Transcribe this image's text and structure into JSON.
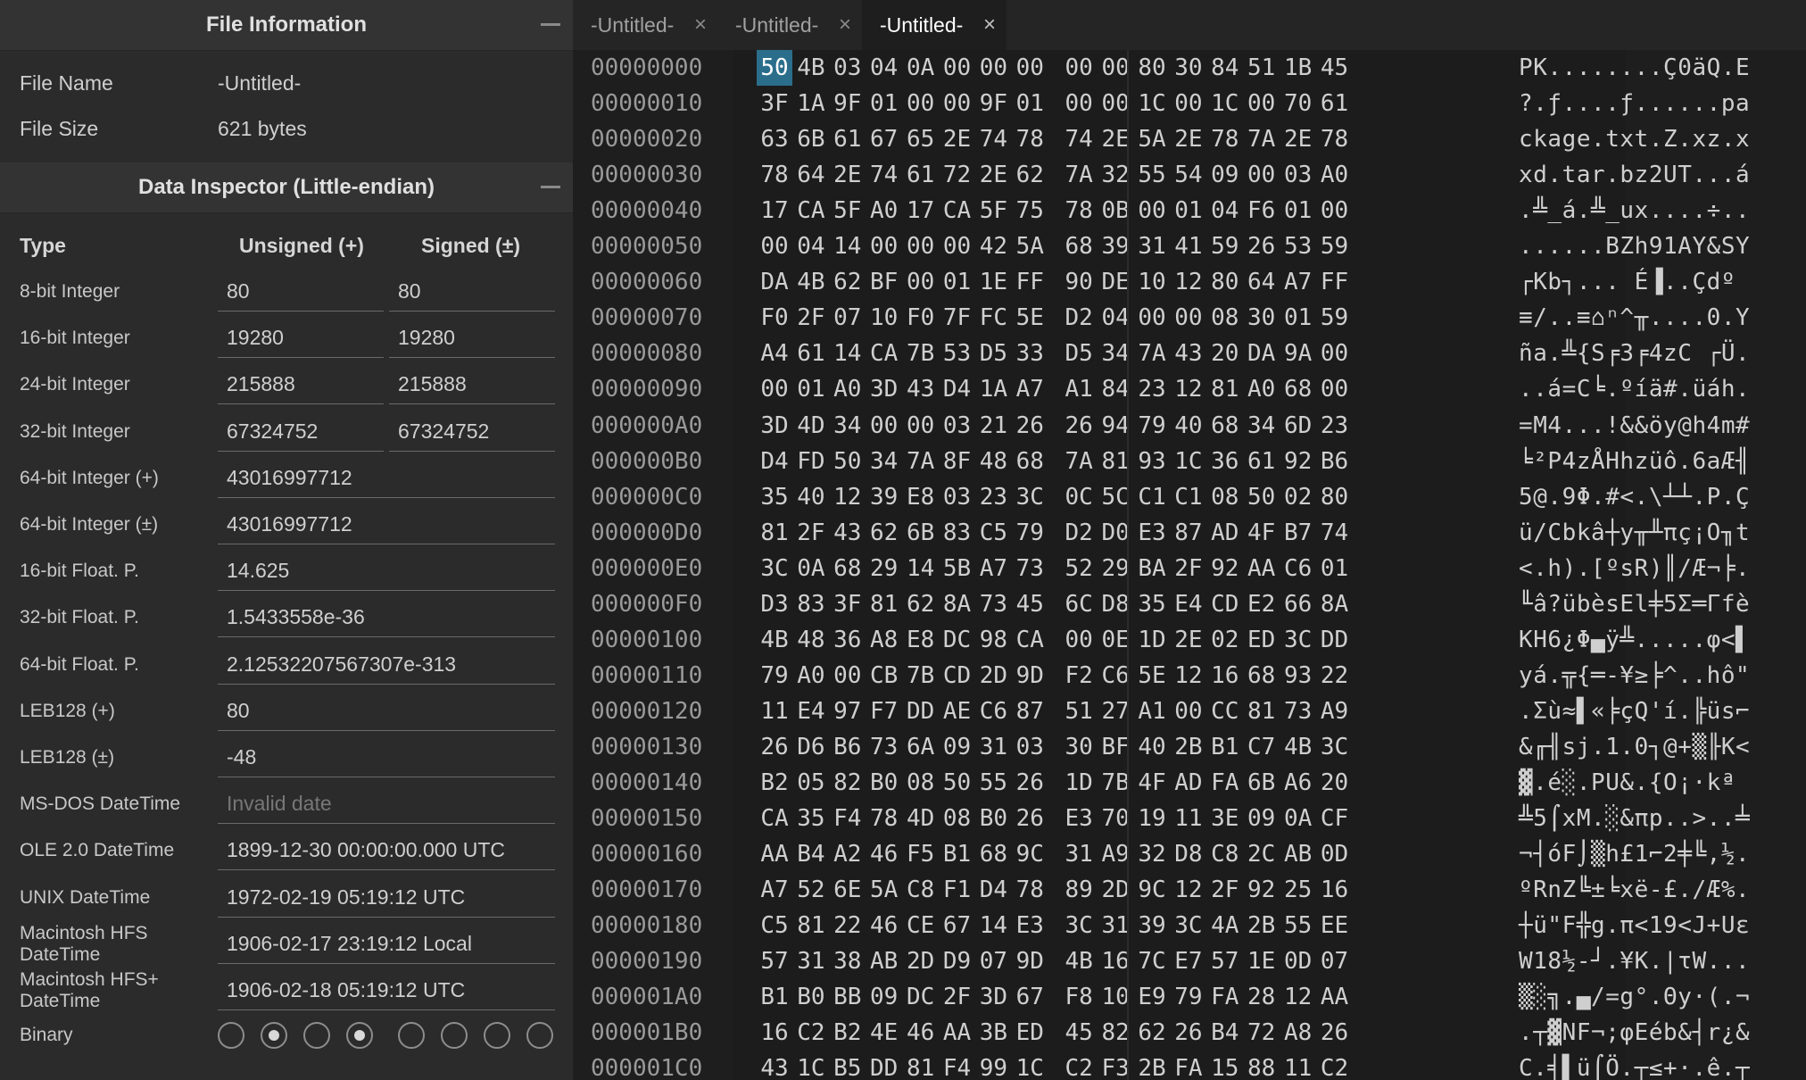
{
  "file_info": {
    "title": "File Information",
    "name_label": "File Name",
    "name_value": "-Untitled-",
    "size_label": "File Size",
    "size_value": "621 bytes"
  },
  "inspector": {
    "title": "Data Inspector (Little-endian)",
    "col_type": "Type",
    "col_unsigned": "Unsigned (+)",
    "col_signed": "Signed (±)",
    "rows": [
      {
        "label": "8-bit Integer",
        "unsigned": "80",
        "signed": "80"
      },
      {
        "label": "16-bit Integer",
        "unsigned": "19280",
        "signed": "19280"
      },
      {
        "label": "24-bit Integer",
        "unsigned": "215888",
        "signed": "215888"
      },
      {
        "label": "32-bit Integer",
        "unsigned": "67324752",
        "signed": "67324752"
      },
      {
        "label": "64-bit Integer (+)",
        "value": "43016997712"
      },
      {
        "label": "64-bit Integer (±)",
        "value": "43016997712"
      },
      {
        "label": "16-bit Float. P.",
        "value": "14.625"
      },
      {
        "label": "32-bit Float. P.",
        "value": "1.5433558e-36"
      },
      {
        "label": "64-bit Float. P.",
        "value": "2.12532207567307e-313"
      },
      {
        "label": "LEB128 (+)",
        "value": "80"
      },
      {
        "label": "LEB128 (±)",
        "value": "-48"
      },
      {
        "label": "MS-DOS DateTime",
        "placeholder": "Invalid date"
      },
      {
        "label": "OLE 2.0 DateTime",
        "value": "1899-12-30 00:00:00.000 UTC"
      },
      {
        "label": "UNIX DateTime",
        "value": "1972-02-19 05:19:12 UTC"
      },
      {
        "label": "Macintosh HFS DateTime",
        "value": "1906-02-17 23:19:12 Local"
      },
      {
        "label": "Macintosh HFS+ DateTime",
        "value": "1906-02-18 05:19:12 UTC"
      }
    ],
    "binary_label": "Binary",
    "binary_bits": [
      0,
      1,
      0,
      1,
      0,
      0,
      0,
      0
    ]
  },
  "tabs": [
    {
      "label": "-Untitled-",
      "active": false
    },
    {
      "label": "-Untitled-",
      "active": false
    },
    {
      "label": "-Untitled-",
      "active": true
    }
  ],
  "tab_close_glyph": "×",
  "colors": {
    "selection": "#2b6e8c",
    "background": "#1e1e1e",
    "panel": "#2b2b2b"
  },
  "hex": {
    "selected_offset": "00000000",
    "selected_byte_index": 0,
    "rows": [
      {
        "offset": "00000000",
        "bytes": [
          "50",
          "4B",
          "03",
          "04",
          "0A",
          "00",
          "00",
          "00",
          "00",
          "00",
          "80",
          "30",
          "84",
          "51",
          "1B",
          "45"
        ],
        "ascii": "PK........Ç0äQ.E"
      },
      {
        "offset": "00000010",
        "bytes": [
          "3F",
          "1A",
          "9F",
          "01",
          "00",
          "00",
          "9F",
          "01",
          "00",
          "00",
          "1C",
          "00",
          "1C",
          "00",
          "70",
          "61"
        ],
        "ascii": "?.ƒ....ƒ......pa"
      },
      {
        "offset": "00000020",
        "bytes": [
          "63",
          "6B",
          "61",
          "67",
          "65",
          "2E",
          "74",
          "78",
          "74",
          "2E",
          "5A",
          "2E",
          "78",
          "7A",
          "2E",
          "78"
        ],
        "ascii": "ckage.txt.Z.xz.x"
      },
      {
        "offset": "00000030",
        "bytes": [
          "78",
          "64",
          "2E",
          "74",
          "61",
          "72",
          "2E",
          "62",
          "7A",
          "32",
          "55",
          "54",
          "09",
          "00",
          "03",
          "A0"
        ],
        "ascii": "xd.tar.bz2UT...á"
      },
      {
        "offset": "00000040",
        "bytes": [
          "17",
          "CA",
          "5F",
          "A0",
          "17",
          "CA",
          "5F",
          "75",
          "78",
          "0B",
          "00",
          "01",
          "04",
          "F6",
          "01",
          "00"
        ],
        "ascii": ".╩_á.╩_ux....÷.."
      },
      {
        "offset": "00000050",
        "bytes": [
          "00",
          "04",
          "14",
          "00",
          "00",
          "00",
          "42",
          "5A",
          "68",
          "39",
          "31",
          "41",
          "59",
          "26",
          "53",
          "59"
        ],
        "ascii": "......BZh91AY&SY"
      },
      {
        "offset": "00000060",
        "bytes": [
          "DA",
          "4B",
          "62",
          "BF",
          "00",
          "01",
          "1E",
          "FF",
          "90",
          "DE",
          "10",
          "12",
          "80",
          "64",
          "A7",
          "FF"
        ],
        "ascii": "┌Kb┐... É▐..Çdº "
      },
      {
        "offset": "00000070",
        "bytes": [
          "F0",
          "2F",
          "07",
          "10",
          "F0",
          "7F",
          "FC",
          "5E",
          "D2",
          "04",
          "00",
          "00",
          "08",
          "30",
          "01",
          "59"
        ],
        "ascii": "≡/..≡⌂ⁿ^╥....0.Y"
      },
      {
        "offset": "00000080",
        "bytes": [
          "A4",
          "61",
          "14",
          "CA",
          "7B",
          "53",
          "D5",
          "33",
          "D5",
          "34",
          "7A",
          "43",
          "20",
          "DA",
          "9A",
          "00"
        ],
        "ascii": "ña.╩{S╒3╒4zC ┌Ü."
      },
      {
        "offset": "00000090",
        "bytes": [
          "00",
          "01",
          "A0",
          "3D",
          "43",
          "D4",
          "1A",
          "A7",
          "A1",
          "84",
          "23",
          "12",
          "81",
          "A0",
          "68",
          "00"
        ],
        "ascii": "..á=C╘.ºíä#.üáh."
      },
      {
        "offset": "000000A0",
        "bytes": [
          "3D",
          "4D",
          "34",
          "00",
          "00",
          "03",
          "21",
          "26",
          "26",
          "94",
          "79",
          "40",
          "68",
          "34",
          "6D",
          "23"
        ],
        "ascii": "=M4...!&&öy@h4m#"
      },
      {
        "offset": "000000B0",
        "bytes": [
          "D4",
          "FD",
          "50",
          "34",
          "7A",
          "8F",
          "48",
          "68",
          "7A",
          "81",
          "93",
          "1C",
          "36",
          "61",
          "92",
          "B6"
        ],
        "ascii": "╘²P4zÅHhzüô.6aÆ╢"
      },
      {
        "offset": "000000C0",
        "bytes": [
          "35",
          "40",
          "12",
          "39",
          "E8",
          "03",
          "23",
          "3C",
          "0C",
          "5C",
          "C1",
          "C1",
          "08",
          "50",
          "02",
          "80"
        ],
        "ascii": "5@.9Φ.#<.\\┴┴.P.Ç"
      },
      {
        "offset": "000000D0",
        "bytes": [
          "81",
          "2F",
          "43",
          "62",
          "6B",
          "83",
          "C5",
          "79",
          "D2",
          "D0",
          "E3",
          "87",
          "AD",
          "4F",
          "B7",
          "74"
        ],
        "ascii": "ü/Cbkâ┼y╥╨πç¡O╖t"
      },
      {
        "offset": "000000E0",
        "bytes": [
          "3C",
          "0A",
          "68",
          "29",
          "14",
          "5B",
          "A7",
          "73",
          "52",
          "29",
          "BA",
          "2F",
          "92",
          "AA",
          "C6",
          "01"
        ],
        "ascii": "<.h).[ºsR)║/Æ¬╞."
      },
      {
        "offset": "000000F0",
        "bytes": [
          "D3",
          "83",
          "3F",
          "81",
          "62",
          "8A",
          "73",
          "45",
          "6C",
          "D8",
          "35",
          "E4",
          "CD",
          "E2",
          "66",
          "8A"
        ],
        "ascii": "╙â?übèsEl╪5Σ═Γfè"
      },
      {
        "offset": "00000100",
        "bytes": [
          "4B",
          "48",
          "36",
          "A8",
          "E8",
          "DC",
          "98",
          "CA",
          "00",
          "0E",
          "1D",
          "2E",
          "02",
          "ED",
          "3C",
          "DD"
        ],
        "ascii": "KH6¿Φ▄ÿ╩.....φ<▌"
      },
      {
        "offset": "00000110",
        "bytes": [
          "79",
          "A0",
          "00",
          "CB",
          "7B",
          "CD",
          "2D",
          "9D",
          "F2",
          "C6",
          "5E",
          "12",
          "16",
          "68",
          "93",
          "22"
        ],
        "ascii": "yá.╦{═-¥≥╞^..hô\""
      },
      {
        "offset": "00000120",
        "bytes": [
          "11",
          "E4",
          "97",
          "F7",
          "DD",
          "AE",
          "C6",
          "87",
          "51",
          "27",
          "A1",
          "00",
          "CC",
          "81",
          "73",
          "A9"
        ],
        "ascii": ".Σù≈▌«╞çQ'í.╠üs⌐"
      },
      {
        "offset": "00000130",
        "bytes": [
          "26",
          "D6",
          "B6",
          "73",
          "6A",
          "09",
          "31",
          "03",
          "30",
          "BF",
          "40",
          "2B",
          "B1",
          "C7",
          "4B",
          "3C"
        ],
        "ascii": "&╓╢sj.1.0┐@+▒╟K<"
      },
      {
        "offset": "00000140",
        "bytes": [
          "B2",
          "05",
          "82",
          "B0",
          "08",
          "50",
          "55",
          "26",
          "1D",
          "7B",
          "4F",
          "AD",
          "FA",
          "6B",
          "A6",
          "20"
        ],
        "ascii": "▓.é░.PU&.{O¡·kª "
      },
      {
        "offset": "00000150",
        "bytes": [
          "CA",
          "35",
          "F4",
          "78",
          "4D",
          "08",
          "B0",
          "26",
          "E3",
          "70",
          "19",
          "11",
          "3E",
          "09",
          "0A",
          "CF"
        ],
        "ascii": "╩5⌠xM.░&πp..>..╧"
      },
      {
        "offset": "00000160",
        "bytes": [
          "AA",
          "B4",
          "A2",
          "46",
          "F5",
          "B1",
          "68",
          "9C",
          "31",
          "A9",
          "32",
          "D8",
          "C8",
          "2C",
          "AB",
          "0D"
        ],
        "ascii": "¬┤óF⌡▒h£1⌐2╪╚,½."
      },
      {
        "offset": "00000170",
        "bytes": [
          "A7",
          "52",
          "6E",
          "5A",
          "C8",
          "F1",
          "D4",
          "78",
          "89",
          "2D",
          "9C",
          "12",
          "2F",
          "92",
          "25",
          "16"
        ],
        "ascii": "ºRnZ╚±╘xë-£./Æ%."
      },
      {
        "offset": "00000180",
        "bytes": [
          "C5",
          "81",
          "22",
          "46",
          "CE",
          "67",
          "14",
          "E3",
          "3C",
          "31",
          "39",
          "3C",
          "4A",
          "2B",
          "55",
          "EE"
        ],
        "ascii": "┼ü\"F╬g.π<19<J+Uε"
      },
      {
        "offset": "00000190",
        "bytes": [
          "57",
          "31",
          "38",
          "AB",
          "2D",
          "D9",
          "07",
          "9D",
          "4B",
          "16",
          "7C",
          "E7",
          "57",
          "1E",
          "0D",
          "07"
        ],
        "ascii": "W18½-┘.¥K.|τW..."
      },
      {
        "offset": "000001A0",
        "bytes": [
          "B1",
          "B0",
          "BB",
          "09",
          "DC",
          "2F",
          "3D",
          "67",
          "F8",
          "10",
          "E9",
          "79",
          "FA",
          "28",
          "12",
          "AA"
        ],
        "ascii": "▒░╗.▄/=g°.Θy·(.¬"
      },
      {
        "offset": "000001B0",
        "bytes": [
          "16",
          "C2",
          "B2",
          "4E",
          "46",
          "AA",
          "3B",
          "ED",
          "45",
          "82",
          "62",
          "26",
          "B4",
          "72",
          "A8",
          "26"
        ],
        "ascii": ".┬▓NF¬;φEéb&┤r¿&"
      },
      {
        "offset": "000001C0",
        "bytes": [
          "43",
          "1C",
          "B5",
          "DD",
          "81",
          "F4",
          "99",
          "1C",
          "C2",
          "F3",
          "2B",
          "FA",
          "15",
          "88",
          "11",
          "C2"
        ],
        "ascii": "C.╡▌ü⌠Ö.┬≤+·.ê.┬"
      }
    ]
  }
}
